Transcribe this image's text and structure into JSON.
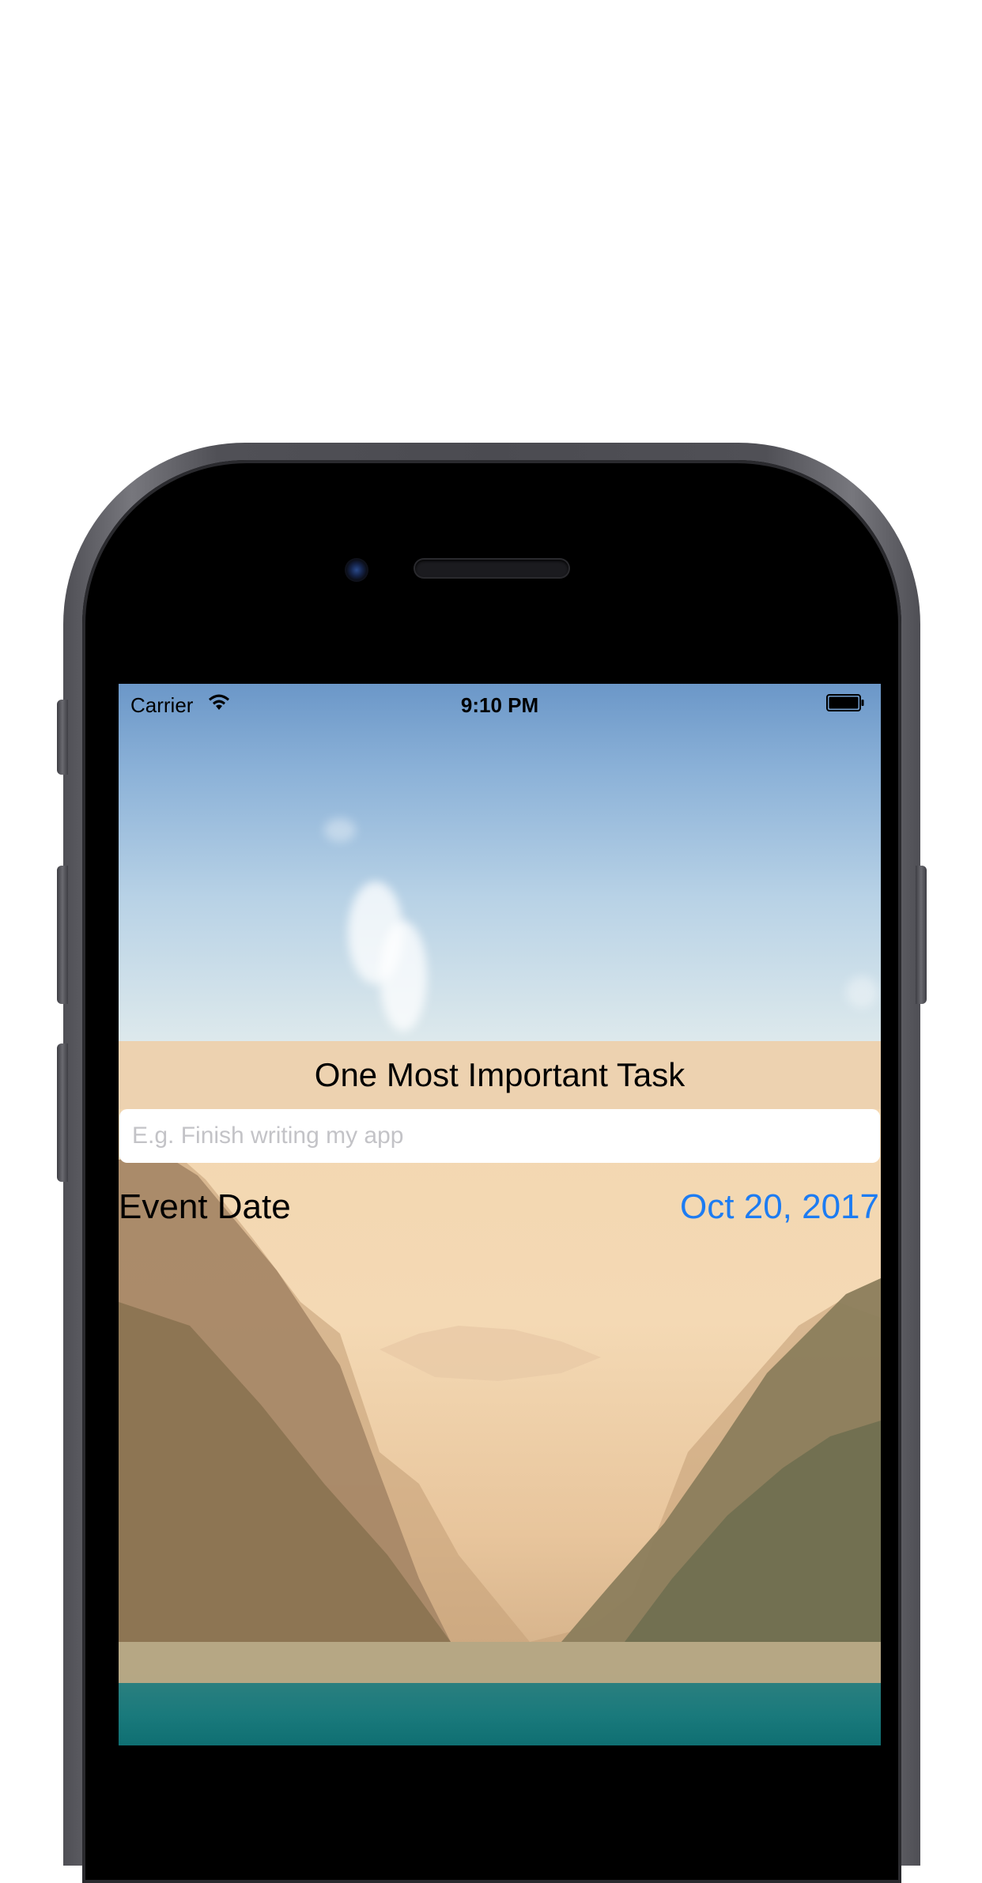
{
  "status_bar": {
    "carrier": "Carrier",
    "time": "9:10 PM"
  },
  "header": {
    "title": "One Most Important Task"
  },
  "task_input": {
    "placeholder": "E.g. Finish writing my app",
    "value": ""
  },
  "event": {
    "label": "Event Date",
    "date": "Oct 20, 2017"
  },
  "colors": {
    "accent": "#1d7cf2",
    "title_band": "#ecd2b0",
    "sky_top": "#6b97c8",
    "water": "#177e80"
  },
  "icons": {
    "wifi": "wifi-icon",
    "battery": "battery-icon"
  }
}
